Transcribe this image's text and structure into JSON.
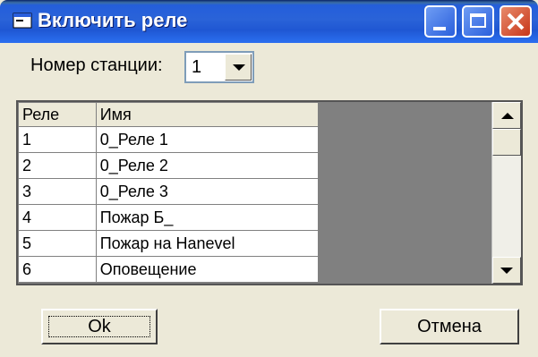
{
  "window": {
    "title": "Включить реле"
  },
  "station": {
    "label": "Номер станции:",
    "value": "1"
  },
  "table": {
    "headers": [
      "Реле",
      "Имя"
    ],
    "rows": [
      [
        "1",
        "0_Реле 1"
      ],
      [
        "2",
        "0_Реле 2"
      ],
      [
        "3",
        "0_Реле 3"
      ],
      [
        "4",
        "Пожар Б_"
      ],
      [
        "5",
        "Пожар на Hanevel"
      ],
      [
        "6",
        "Оповещение"
      ]
    ]
  },
  "buttons": {
    "ok": "Ok",
    "cancel": "Отмена"
  },
  "icons": {
    "title": "window-icon",
    "minimize": "minimize-icon",
    "maximize": "maximize-icon",
    "close": "close-icon",
    "dropdown": "chevron-down-icon",
    "scroll_up": "arrow-up-icon",
    "scroll_down": "arrow-down-icon"
  },
  "colors": {
    "titlebar": "#245edb",
    "close_button": "#c7361a",
    "face": "#ece9d8",
    "grid_empty": "#808080"
  }
}
